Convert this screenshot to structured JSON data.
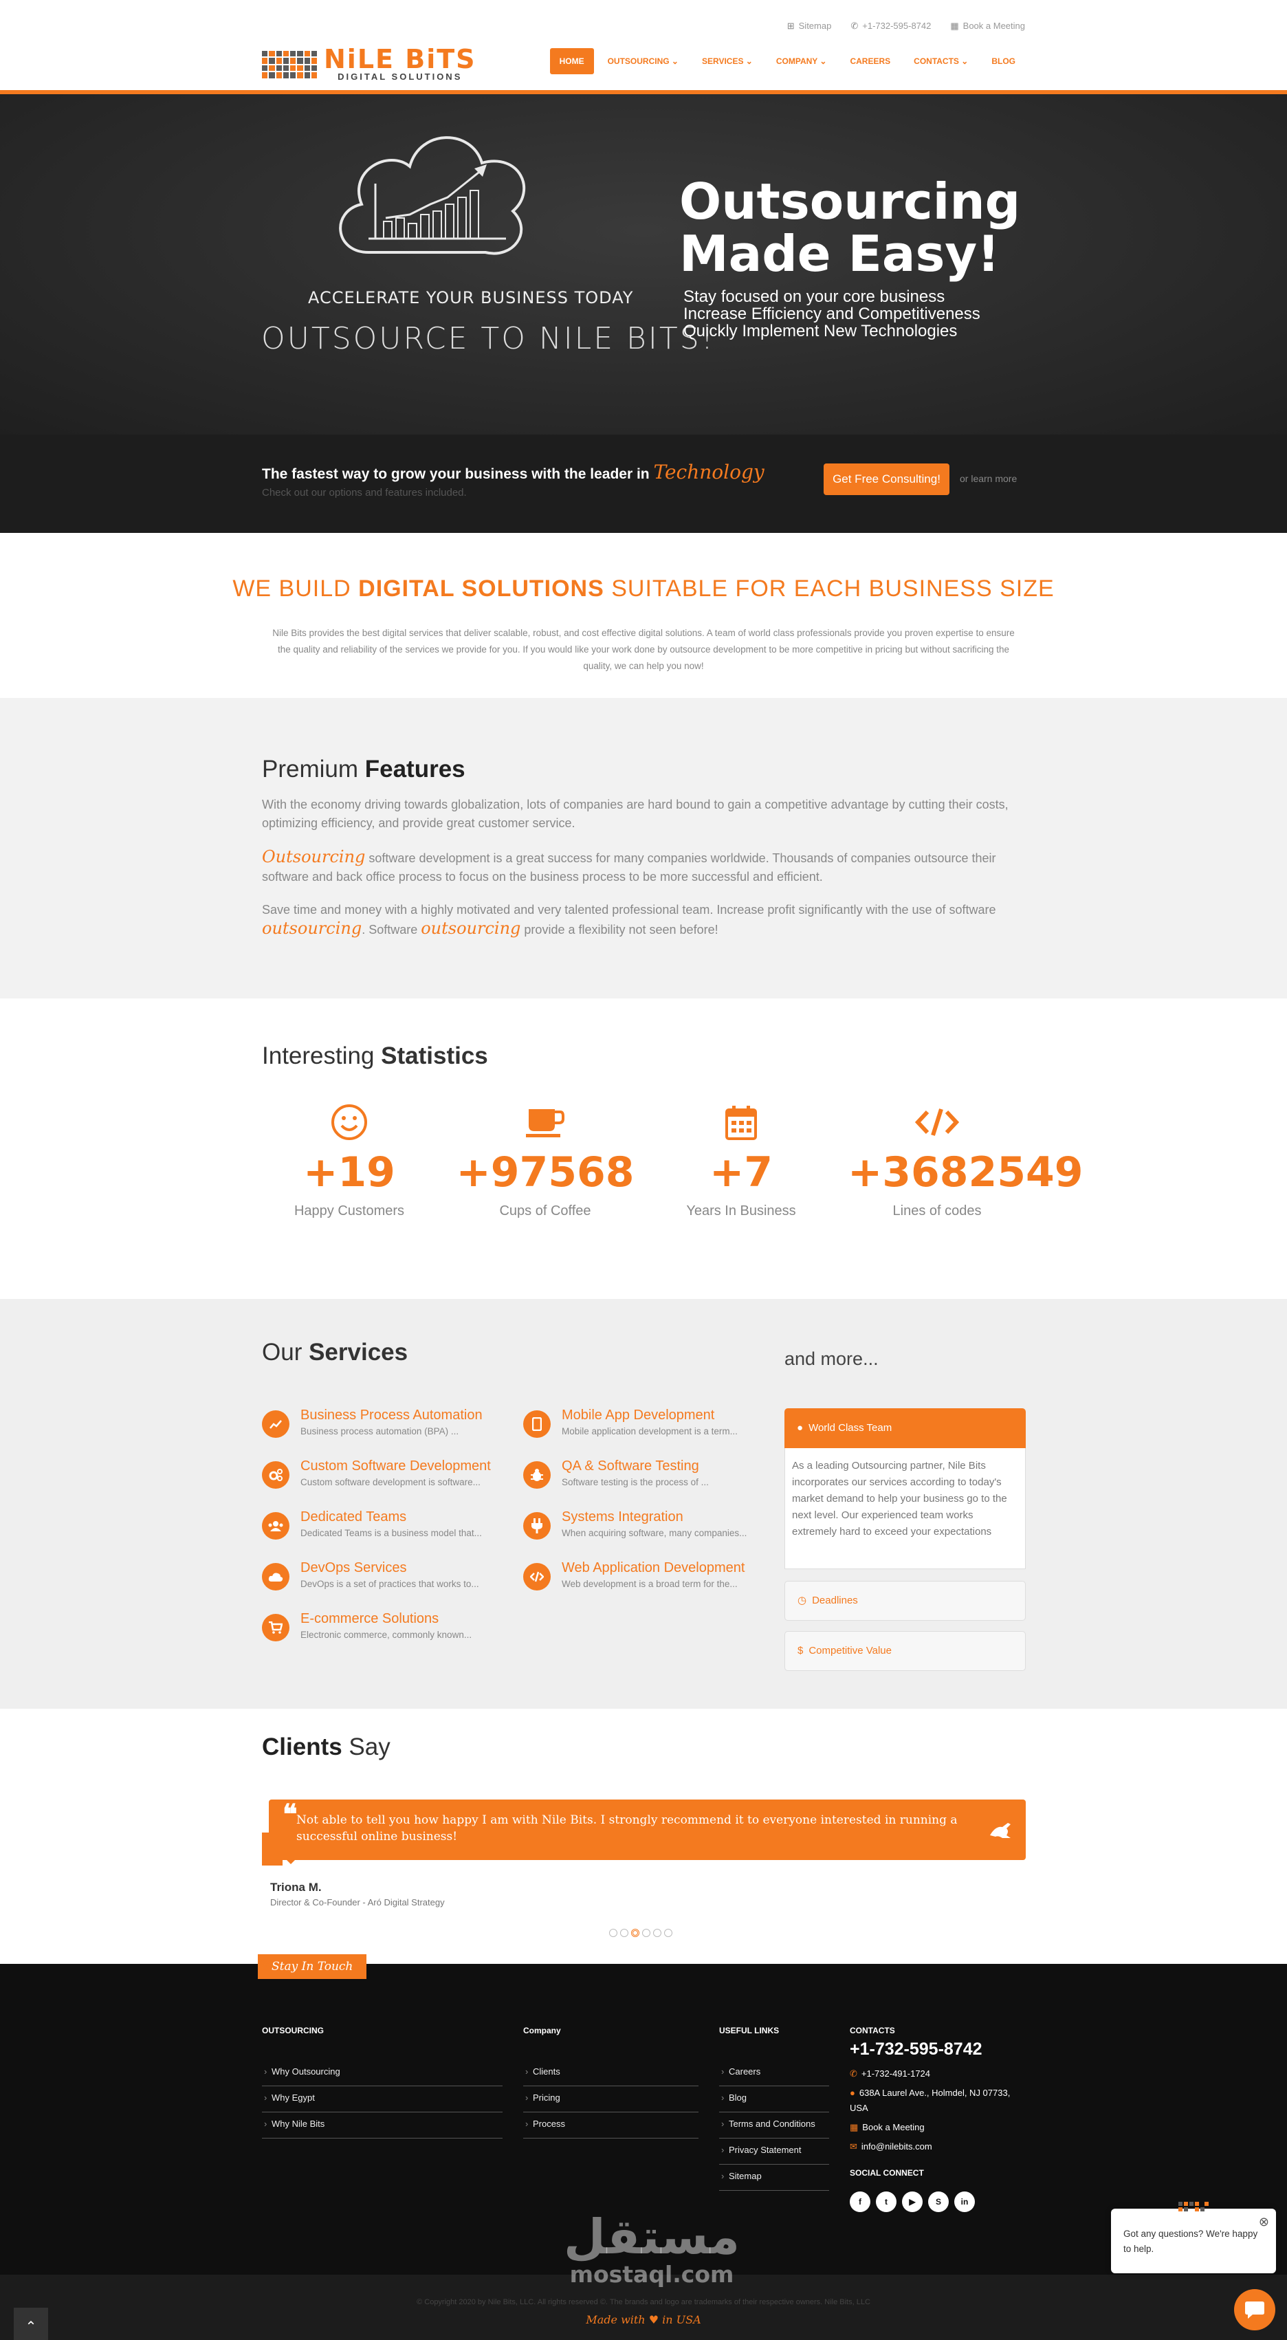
{
  "topbar": {
    "sitemap": "Sitemap",
    "phone": "+1-732-595-8742",
    "meeting": "Book a Meeting"
  },
  "logo": {
    "name": "NiLE BiTS",
    "tagline": "DIGITAL SOLUTIONS"
  },
  "nav": [
    "HOME",
    "OUTSOURCING ⌄",
    "SERVICES ⌄",
    "COMPANY ⌄",
    "CAREERS",
    "CONTACTS ⌄",
    "BLOG"
  ],
  "hero": {
    "accelerate": "ACCELERATE YOUR BUSINESS TODAY",
    "outsource": "OUTSOURCE TO NILE BITS!",
    "title_1": "Outsourcing",
    "title_2": "Made Easy!",
    "lines": [
      "Stay focused on your core business",
      "Increase Efficiency and Competitiveness",
      "Quickly Implement New Technologies"
    ]
  },
  "consult": {
    "headline": "The fastest way to grow your business with the leader in",
    "headline_accent": "Technology",
    "sub": "Check out our options and features included.",
    "button": "Get Free Consulting!",
    "learn": "or learn more"
  },
  "build": {
    "h_pre": "WE BUILD ",
    "h_bold": "DIGITAL SOLUTIONS",
    "h_post": " SUITABLE FOR EACH BUSINESS SIZE",
    "p": "Nile Bits provides the best digital services that deliver scalable, robust, and cost effective digital solutions. A team of world class professionals provide you proven expertise to ensure the quality and reliability of the services we provide for you. If you would like your work done by outsource development to be more competitive in pricing but without sacrificing the quality, we can help you now!"
  },
  "premium": {
    "title_pre": "Premium ",
    "title_bold": "Features",
    "p1": "With the economy driving towards globalization, lots of companies are hard bound to gain a competitive advantage by cutting their costs, optimizing efficiency, and provide great customer service.",
    "p2_accent": "Outsourcing",
    "p2": " software development is a great success for many companies worldwide. Thousands of companies outsource their software and back office process to focus on the business process to be more successful and efficient.",
    "p3a": "Save time and money with a highly motivated and very talented professional team. Increase profit significantly with the use of software ",
    "p3_accent1": "outsourcing",
    "p3b": ". Software ",
    "p3_accent2": "outsourcing",
    "p3c": " provide a flexibility not seen before!"
  },
  "stats": {
    "title_pre": "Interesting ",
    "title_bold": "Statistics",
    "items": [
      {
        "icon": "smile-icon",
        "value": "+19",
        "label": "Happy Customers"
      },
      {
        "icon": "coffee-icon",
        "value": "+97568",
        "label": "Cups of Coffee"
      },
      {
        "icon": "calendar-icon",
        "value": "+7",
        "label": "Years In Business"
      },
      {
        "icon": "code-icon",
        "value": "+3682549",
        "label": "Lines of codes"
      }
    ]
  },
  "services": {
    "title_pre": "Our ",
    "title_bold": "Services",
    "items": [
      {
        "title": "Business Process Automation",
        "desc": "Business process automation (BPA) ..."
      },
      {
        "title": "Mobile App Development",
        "desc": "Mobile application development is a term..."
      },
      {
        "title": "Custom Software Development",
        "desc": "Custom software development is software..."
      },
      {
        "title": "QA & Software Testing",
        "desc": "Software testing is the process of ..."
      },
      {
        "title": "Dedicated Teams",
        "desc": "Dedicated Teams is a business model that..."
      },
      {
        "title": "Systems Integration",
        "desc": "When acquiring software, many companies..."
      },
      {
        "title": "DevOps Services",
        "desc": "DevOps is a set of practices that works to..."
      },
      {
        "title": "Web Application Development",
        "desc": "Web development is a broad term for the..."
      },
      {
        "title": "E-commerce Solutions",
        "desc": "Electronic commerce, commonly known..."
      }
    ],
    "more": "and more...",
    "accordion": {
      "open_title": "World Class Team",
      "open_body": "As a leading Outsourcing partner, Nile Bits incorporates our services according to today's market demand to help your business go to the next level. Our experienced team works extremely hard to exceed your expectations",
      "item2": "Deadlines",
      "item3": "Competitive Value"
    }
  },
  "clients": {
    "title_bold": "Clients",
    "title_post": " Say",
    "quote": "Not able to tell you how happy I am with Nile Bits. I strongly recommend it to everyone interested in running a successful online business!",
    "name": "Triona M.",
    "role": "Director & Co-Founder - Aró Digital Strategy"
  },
  "footer": {
    "tab": "Stay In Touch",
    "outsourcing": {
      "title": "OUTSOURCING",
      "items": [
        "Why Outsourcing",
        "Why Egypt",
        "Why Nile Bits"
      ]
    },
    "company": {
      "title": "Company",
      "items": [
        "Clients",
        "Pricing",
        "Process"
      ]
    },
    "useful": {
      "title": "USEFUL LINKS",
      "items": [
        "Careers",
        "Blog",
        "Terms and Conditions",
        "Privacy Statement",
        "Sitemap"
      ]
    },
    "contacts": {
      "title": "CONTACTS",
      "phone": "+1-732-595-8742",
      "phone2": "+1-732-491-1724",
      "address": "638A Laurel Ave., Holmdel, NJ 07733, USA",
      "meeting": "Book a Meeting",
      "email": "info@nilebits.com",
      "social": "SOCIAL CONNECT"
    }
  },
  "copyright": {
    "text": "© Copyright 2020 by Nile Bits, LLC. All rights reserved ©. The brands and logo are trademarks of their respective owners. Nile Bits, LLC",
    "made": "Made with ♥ in USA"
  },
  "watermark": {
    "ar": "مستقل",
    "en": "mostaql.com"
  },
  "chat": {
    "text": "Got any questions? We're happy to help."
  }
}
